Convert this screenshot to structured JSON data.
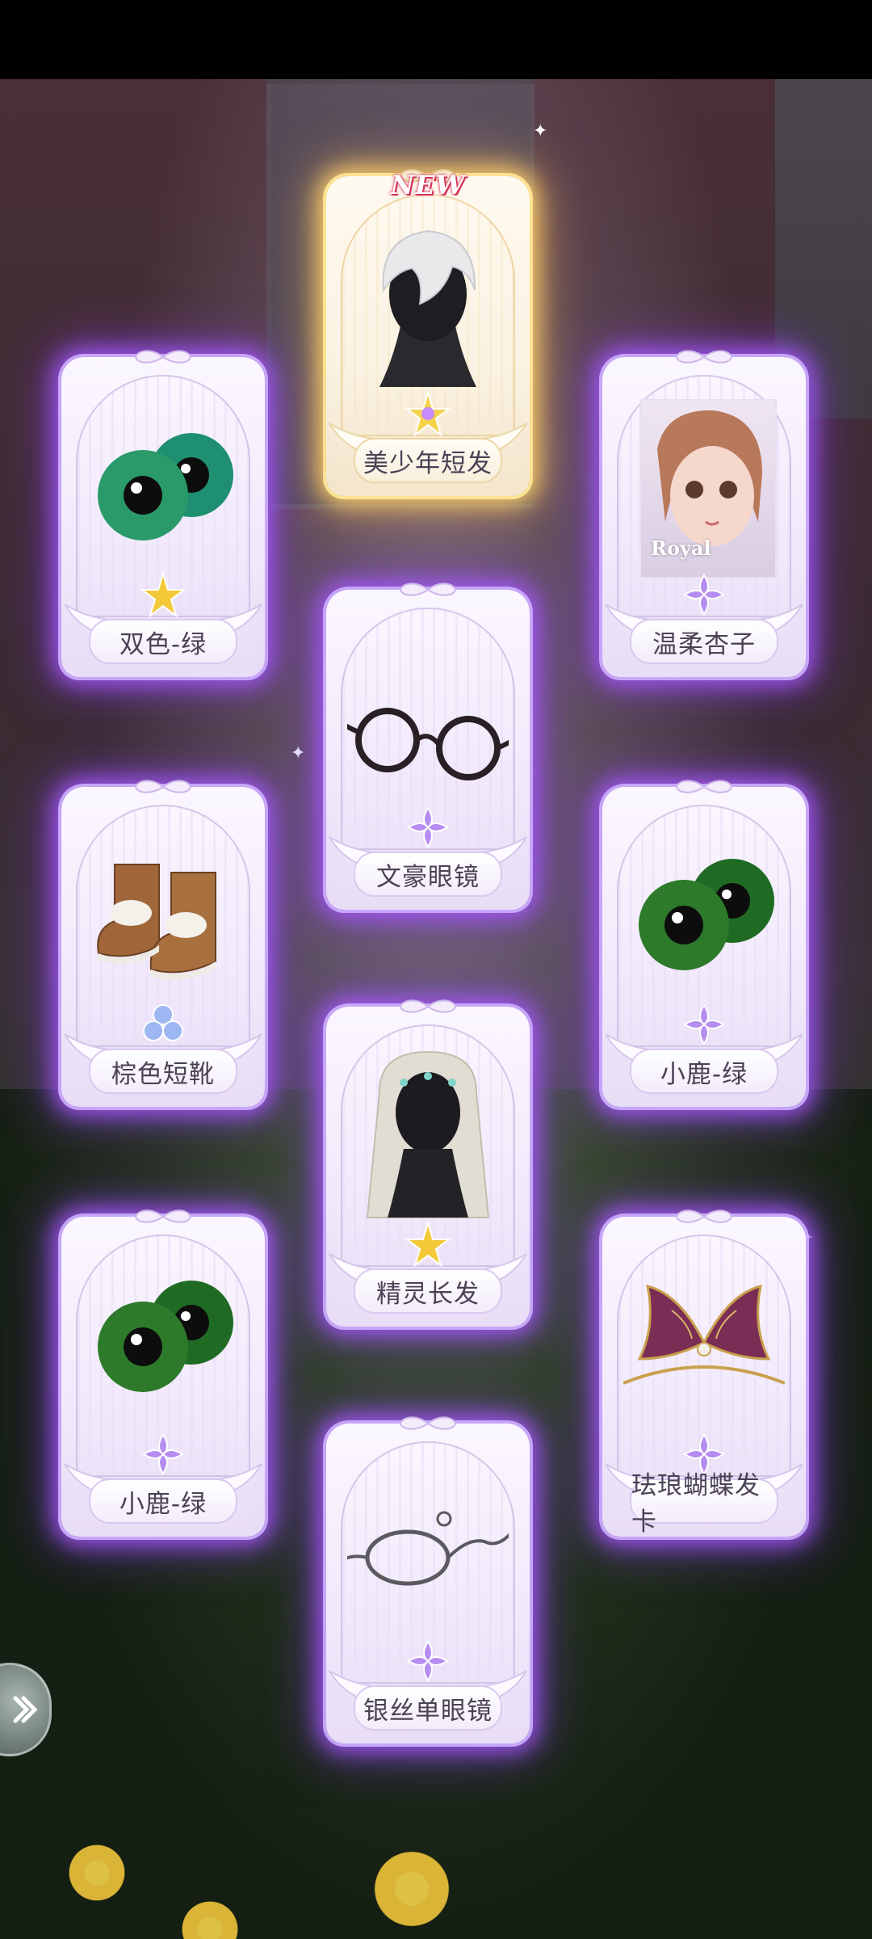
{
  "items": [
    {
      "name": "美少年短发",
      "art": "silver-short-hair-icon",
      "rarity": "gold",
      "star": "rainbow-flower-icon",
      "badge": "NEW"
    },
    {
      "name": "双色-绿",
      "art": "green-eyes-icon",
      "rarity": "purple",
      "star": "gold-star-icon"
    },
    {
      "name": "温柔杏子",
      "art": "portrait-icon",
      "rarity": "purple",
      "star": "purple-flower-icon",
      "portrait_label": "Royal"
    },
    {
      "name": "文豪眼镜",
      "art": "round-glasses-icon",
      "rarity": "purple",
      "star": "purple-flower-icon"
    },
    {
      "name": "棕色短靴",
      "art": "brown-boots-icon",
      "rarity": "white",
      "star": "blue-flower-icon"
    },
    {
      "name": "小鹿-绿",
      "art": "green-eyes-icon",
      "rarity": "purple",
      "star": "purple-flower-icon"
    },
    {
      "name": "精灵长发",
      "art": "elf-long-hair-icon",
      "rarity": "purple",
      "star": "gold-star-icon"
    },
    {
      "name": "小鹿-绿",
      "art": "green-eyes-icon",
      "rarity": "purple",
      "star": "purple-flower-icon"
    },
    {
      "name": "珐琅蝴蝶发卡",
      "art": "butterfly-hairpin-icon",
      "rarity": "purple",
      "star": "purple-flower-icon"
    },
    {
      "name": "银丝单眼镜",
      "art": "monocle-icon",
      "rarity": "purple",
      "star": "purple-flower-icon"
    }
  ],
  "colors": {
    "purple_glow": "#a45cff",
    "gold_glow": "#ffd26e",
    "name_text": "#4a4255"
  }
}
